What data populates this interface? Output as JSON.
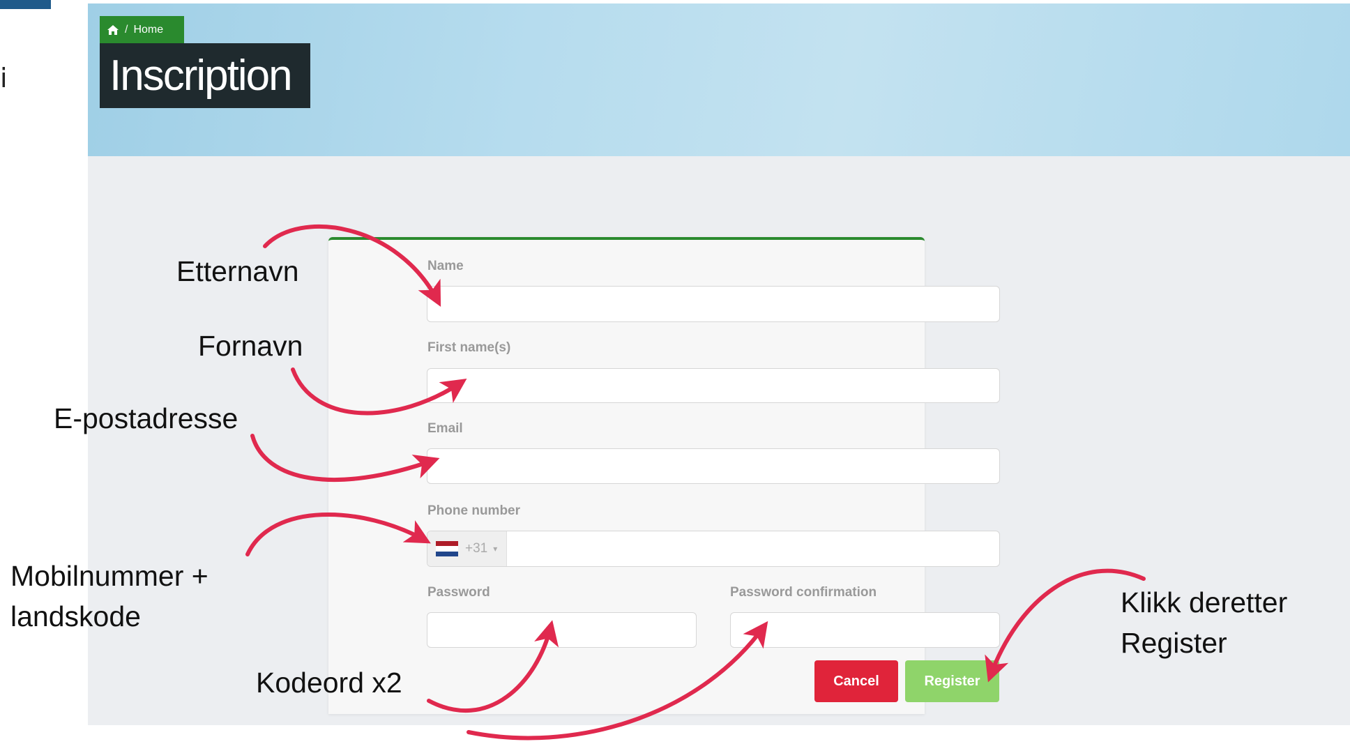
{
  "page": {
    "corner_char": "i",
    "breadcrumb": "Home",
    "title": "Inscription"
  },
  "form": {
    "name_label": "Name",
    "first_name_label": "First name(s)",
    "email_label": "Email",
    "phone_label": "Phone number",
    "phone_prefix": "+31",
    "phone_flag": "netherlands-flag",
    "password_label": "Password",
    "password_confirmation_label": "Password confirmation",
    "cancel_label": "Cancel",
    "register_label": "Register"
  },
  "annotations": {
    "etternavn": "Etternavn",
    "fornavn": "Fornavn",
    "epost": "E-postadresse",
    "mobil_line1": "Mobilnummer +",
    "mobil_line2": "landskode",
    "kodeord": "Kodeord x2",
    "klikk_line1": "Klikk deretter",
    "klikk_line2": "Register"
  },
  "colors": {
    "accent_green": "#2a8a2e",
    "cancel_red": "#e0243a",
    "register_green": "#8fd46a",
    "arrow_red": "#e0294e"
  }
}
